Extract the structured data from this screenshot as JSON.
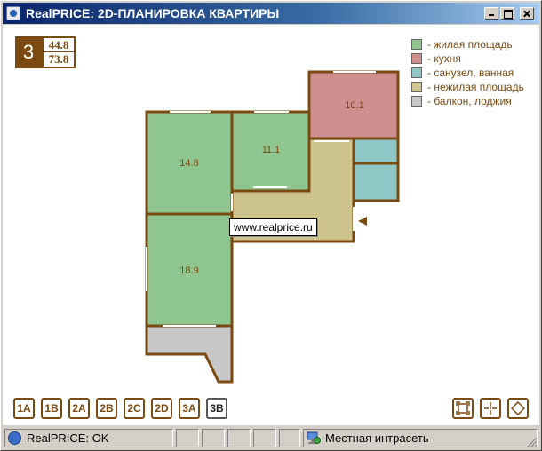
{
  "window": {
    "title": "RealPRICE: 2D-ПЛАНИРОВКА КВАРТИРЫ"
  },
  "badge": {
    "rooms": "3",
    "living_area": "44.8",
    "total_area": "73.8"
  },
  "legend": [
    {
      "label": "- жилая площадь",
      "color": "#8fc58f"
    },
    {
      "label": "- кухня",
      "color": "#cf8f8f"
    },
    {
      "label": "- санузел, ванная",
      "color": "#8fc6c6"
    },
    {
      "label": "- нежилая площадь",
      "color": "#cfc58f"
    },
    {
      "label": "- балкон, лоджия",
      "color": "#c8c8c8"
    }
  ],
  "rooms": {
    "r1": "14.8",
    "r2": "11.1",
    "kitchen": "10.1",
    "r3": "18.9"
  },
  "colors": {
    "wall": "#7a4a12",
    "living": "#8fc58f",
    "kitchen": "#cf8f8f",
    "bath": "#8fc6c6",
    "hall": "#cfc58f",
    "balcony": "#c8c8c8"
  },
  "tooltip": "www.realprice.ru",
  "plan_buttons": [
    {
      "label": "1A",
      "active": false
    },
    {
      "label": "1B",
      "active": false
    },
    {
      "label": "2A",
      "active": false
    },
    {
      "label": "2B",
      "active": false
    },
    {
      "label": "2C",
      "active": false
    },
    {
      "label": "2D",
      "active": false
    },
    {
      "label": "3A",
      "active": false
    },
    {
      "label": "3B",
      "active": true
    }
  ],
  "view_buttons": [
    "fit-icon",
    "move-icon",
    "diamond-icon"
  ],
  "status": {
    "text": "RealPRICE: OK",
    "zone": "Местная интрасеть"
  }
}
